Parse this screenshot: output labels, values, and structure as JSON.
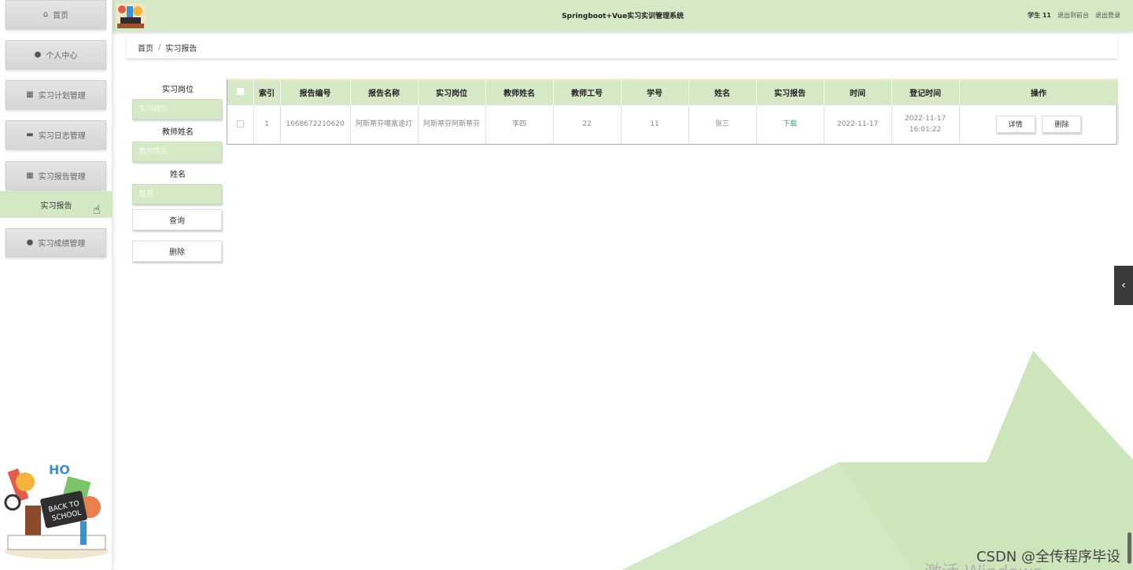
{
  "app": {
    "title": "Springboot+Vue实习实训管理系统"
  },
  "header": {
    "user": "学生 11",
    "back_label": "退出到前台",
    "logout_label": "退出登录"
  },
  "sidebar": {
    "items": [
      {
        "label": "首页",
        "icon": "home-icon"
      },
      {
        "label": "个人中心",
        "icon": "user-icon"
      },
      {
        "label": "实习计划管理",
        "icon": "grid-icon"
      },
      {
        "label": "实习日志管理",
        "icon": "briefcase-icon"
      },
      {
        "label": "实习报告管理",
        "icon": "grid-icon"
      },
      {
        "label": "实习成绩管理",
        "icon": "location-icon"
      }
    ],
    "active_sub": "实习报告"
  },
  "breadcrumb": {
    "home": "首页",
    "separator": "/",
    "current": "实习报告"
  },
  "search": {
    "fields": [
      {
        "label": "实习岗位",
        "placeholder": "实习岗位"
      },
      {
        "label": "教师姓名",
        "placeholder": "教师姓名"
      },
      {
        "label": "姓名",
        "placeholder": "姓名"
      }
    ],
    "query_label": "查询",
    "delete_label": "删除"
  },
  "table": {
    "headers": [
      "索引",
      "报告编号",
      "报告名称",
      "实习岗位",
      "教师姓名",
      "教师工号",
      "学号",
      "姓名",
      "实习报告",
      "时间",
      "登记时间",
      "操作"
    ],
    "rows": [
      {
        "index": "1",
        "report_no": "1668672210620",
        "report_name": "阿斯蒂芬噶富途灯",
        "post": "阿斯蒂芬阿斯蒂芬",
        "teacher_name": "李四",
        "teacher_no": "22",
        "student_no": "11",
        "name": "张三",
        "report_link": "下载",
        "time": "2022-11-17",
        "reg_time": "2022-11-17 16:01:22",
        "detail_label": "详情",
        "delete_label": "删除"
      }
    ]
  },
  "colors": {
    "accent": "#d6e9c6",
    "link": "#3aa56b"
  },
  "watermark": "CSDN @全传程序毕设",
  "os_watermark": "激活 Windows"
}
